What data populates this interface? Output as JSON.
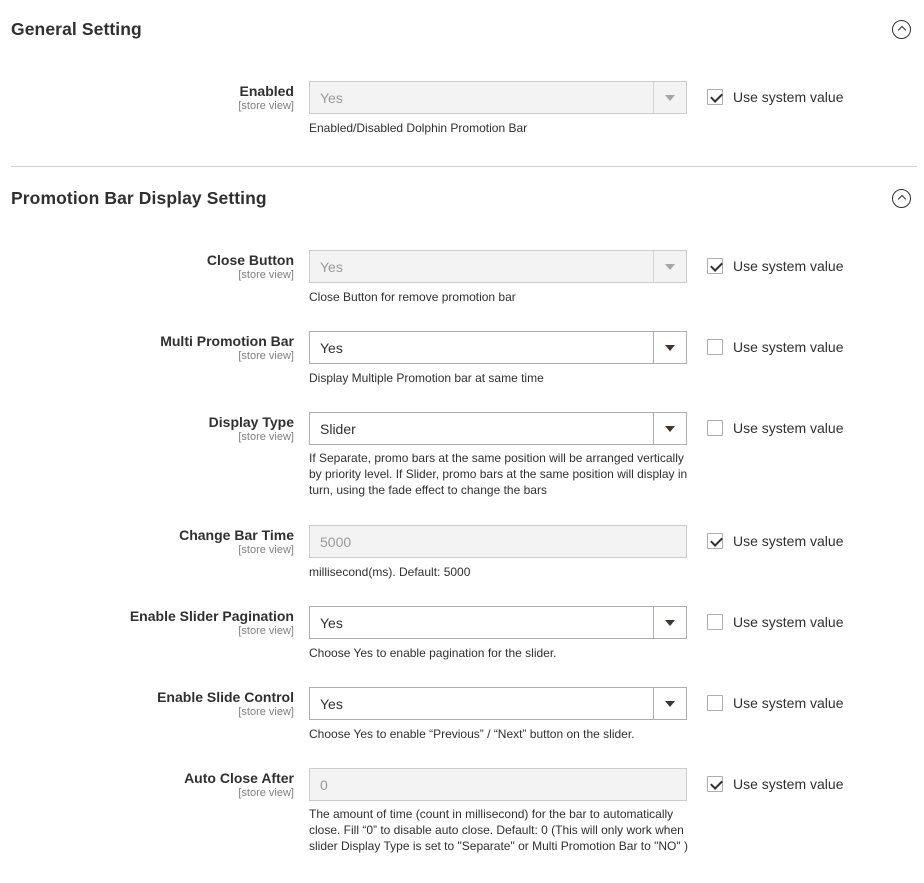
{
  "sections": {
    "general": {
      "title": "General Setting"
    },
    "display": {
      "title": "Promotion Bar Display Setting"
    }
  },
  "icons": {
    "collapse": "chevron-up-circle-icon",
    "select_arrow": "triangle-down-icon",
    "check": "checkmark-icon"
  },
  "colors": {
    "text": "#303030",
    "scope": "#808080",
    "border": "#adadad",
    "disabled_bg": "#f3f3f3",
    "divider": "#d1d1d1"
  },
  "use_system_value_label": "Use system value",
  "fields": {
    "enabled": {
      "label": "Enabled",
      "scope": "[store view]",
      "value": "Yes",
      "note": "Enabled/Disabled Dolphin Promotion Bar",
      "use_system": true
    },
    "close_button": {
      "label": "Close Button",
      "scope": "[store view]",
      "value": "Yes",
      "note": "Close Button for remove promotion bar",
      "use_system": true
    },
    "multi_promotion_bar": {
      "label": "Multi Promotion Bar",
      "scope": "[store view]",
      "value": "Yes",
      "note": "Display Multiple Promotion bar at same time",
      "use_system": false
    },
    "display_type": {
      "label": "Display Type",
      "scope": "[store view]",
      "value": "Slider",
      "note": "If Separate, promo bars at the same position will be arranged vertically by priority level. If Slider, promo bars at the same position will display in turn, using the fade effect to change the bars",
      "use_system": false
    },
    "change_bar_time": {
      "label": "Change Bar Time",
      "scope": "[store view]",
      "value": "5000",
      "note": "millisecond(ms). Default: 5000",
      "use_system": true
    },
    "slider_pagination": {
      "label": "Enable Slider Pagination",
      "scope": "[store view]",
      "value": "Yes",
      "note": "Choose Yes to enable pagination for the slider.",
      "use_system": false
    },
    "slide_control": {
      "label": "Enable Slide Control",
      "scope": "[store view]",
      "value": "Yes",
      "note": "Choose Yes to enable “Previous” / “Next” button on the slider.",
      "use_system": false
    },
    "auto_close_after": {
      "label": "Auto Close After",
      "scope": "[store view]",
      "value": "0",
      "note": "The amount of time (count in millisecond) for the bar to automatically close. Fill “0” to disable auto close. Default: 0 (This will only work when slider Display Type is set to \"Separate\" or Multi Promotion Bar to \"NO\" )",
      "use_system": true
    }
  }
}
